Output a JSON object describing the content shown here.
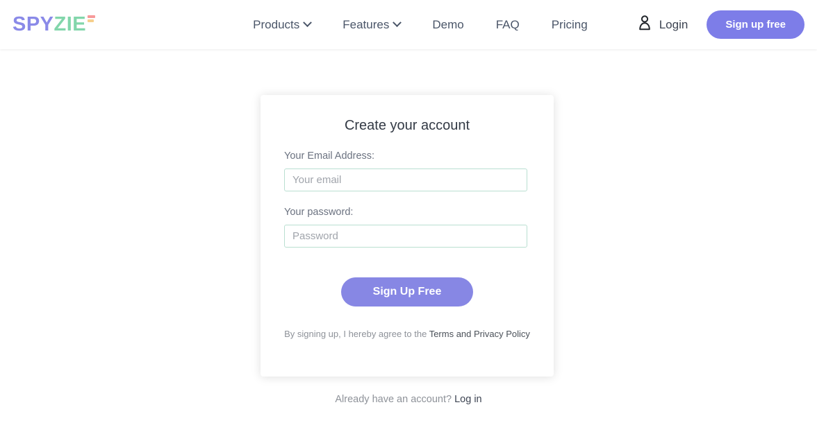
{
  "header": {
    "logo": {
      "part1": "SPY",
      "part2": "ZIE",
      "part1_color": "#8a8ae8",
      "part2_color": "#82d6ab",
      "mark1_color": "#f79a9a",
      "mark2_color": "#f6cf8c"
    },
    "nav": [
      {
        "label": "Products",
        "has_dropdown": true
      },
      {
        "label": "Features",
        "has_dropdown": true
      },
      {
        "label": "Demo",
        "has_dropdown": false
      },
      {
        "label": "FAQ",
        "has_dropdown": false
      },
      {
        "label": "Pricing",
        "has_dropdown": false
      }
    ],
    "login_label": "Login",
    "login_icon": "user-icon",
    "signup_button_label": "Sign up free",
    "signup_button_color": "#7d7de8"
  },
  "card": {
    "title": "Create your account",
    "email": {
      "label": "Your Email Address:",
      "placeholder": "Your email",
      "value": ""
    },
    "password": {
      "label": "Your password:",
      "placeholder": "Password",
      "value": ""
    },
    "submit_label": "Sign Up Free",
    "submit_color": "#8787e4",
    "terms_prefix": "By signing up, I hereby agree to the ",
    "terms_link": "Terms and Privacy Policy",
    "input_border_color": "#b9dfd1"
  },
  "footer": {
    "already_text": "Already have an account? ",
    "login_link": "Log in"
  }
}
